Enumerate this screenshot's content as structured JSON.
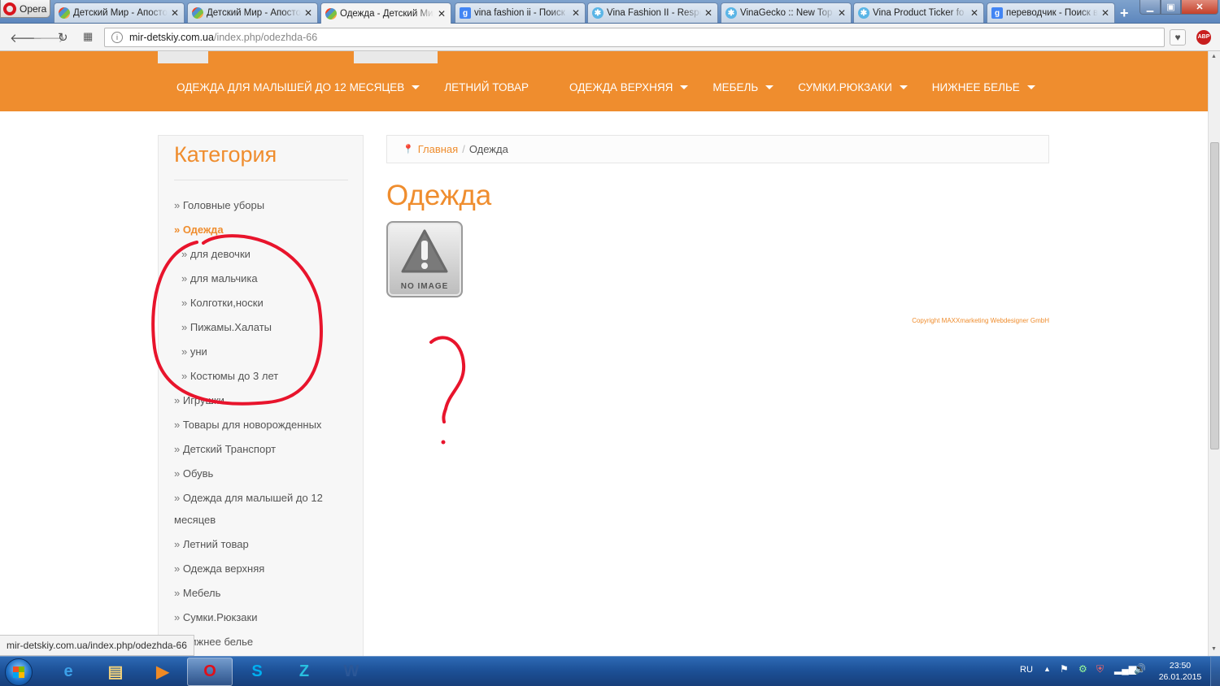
{
  "browser": {
    "app_name": "Opera",
    "tabs": [
      {
        "title": "Детский Мир - Апостол",
        "icon": "joomla-icon",
        "active": false
      },
      {
        "title": "Детский Мир - Апостол",
        "icon": "joomla-icon",
        "active": false
      },
      {
        "title": "Одежда - Детский Мир",
        "icon": "joomla-icon",
        "active": true
      },
      {
        "title": "vina fashion ii - Поиск",
        "icon": "google-icon",
        "active": false
      },
      {
        "title": "Vina Fashion II - Respo",
        "icon": "vina-icon",
        "active": false
      },
      {
        "title": "VinaGecko :: New Top",
        "icon": "vina-icon",
        "active": false
      },
      {
        "title": "Vina Product Ticker fo",
        "icon": "vina-icon",
        "active": false
      },
      {
        "title": "переводчик - Поиск в",
        "icon": "google-icon",
        "active": false
      }
    ],
    "url_host": "mir-detskiy.com.ua",
    "url_path": "/index.php/odezhda-66",
    "status_url": "mir-detskiy.com.ua/index.php/odezhda-66",
    "adblock_label": "ABP"
  },
  "site": {
    "accent_color": "#ef8d2e",
    "nav": [
      {
        "label": "ОДЕЖДА ДЛЯ МАЛЫШЕЙ ДО 12 МЕСЯЦЕВ",
        "dropdown": true
      },
      {
        "label": "ЛЕТНИЙ ТОВАР",
        "dropdown": false
      },
      {
        "label": "ОДЕЖДА ВЕРХНЯЯ",
        "dropdown": true
      },
      {
        "label": "МЕБЕЛЬ",
        "dropdown": true
      },
      {
        "label": "СУМКИ.РЮКЗАКИ",
        "dropdown": true
      },
      {
        "label": "НИЖНЕЕ БЕЛЬЕ",
        "dropdown": true
      }
    ],
    "sidebar": {
      "title": "Категория",
      "items": [
        {
          "label": "Головные уборы",
          "level": 0
        },
        {
          "label": "Одежда",
          "level": 0,
          "active": true
        },
        {
          "label": "для девочки",
          "level": 1
        },
        {
          "label": "для мальчика",
          "level": 1
        },
        {
          "label": "Колготки,носки",
          "level": 1
        },
        {
          "label": "Пижамы.Халаты",
          "level": 1
        },
        {
          "label": "уни",
          "level": 1
        },
        {
          "label": "Костюмы до 3 лет",
          "level": 1
        },
        {
          "label": "Игрушки",
          "level": 0
        },
        {
          "label": "Товары для новорожденных",
          "level": 0
        },
        {
          "label": "Детский Транспорт",
          "level": 0
        },
        {
          "label": "Обувь",
          "level": 0
        },
        {
          "label": "Одежда для малышей до 12 месяцев",
          "level": 0
        },
        {
          "label": "Летний товар",
          "level": 0
        },
        {
          "label": "Одежда верхняя",
          "level": 0
        },
        {
          "label": "Мебель",
          "level": 0
        },
        {
          "label": "Сумки.Рюкзаки",
          "level": 0
        },
        {
          "label": "Нижнее белье",
          "level": 0
        }
      ]
    },
    "breadcrumb": {
      "home": "Главная",
      "separator": "/",
      "current": "Одежда"
    },
    "page_title": "Одежда",
    "placeholder_image_label": "NO IMAGE",
    "copyright": "Copyright MAXXmarketing Webdesigner GmbH"
  },
  "annotation": {
    "color": "#e8142c",
    "mark": "?"
  },
  "taskbar": {
    "apps": [
      "internet-explorer-icon",
      "file-explorer-icon",
      "media-player-icon",
      "opera-icon",
      "skype-icon",
      "z-app-icon",
      "word-icon"
    ],
    "language": "RU",
    "time": "23:50",
    "date": "26.01.2015"
  }
}
